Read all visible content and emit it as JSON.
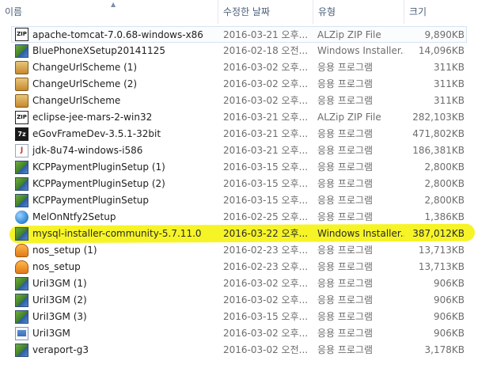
{
  "columns": {
    "name": "이름",
    "date": "수정한 날짜",
    "type": "유형",
    "size": "크기"
  },
  "files": [
    {
      "name": "apache-tomcat-7.0.68-windows-x86",
      "date": "2016-03-21 오후...",
      "type": "ALZip ZIP File",
      "size": "9,890KB",
      "icon": "zip-icon",
      "selected": true
    },
    {
      "name": "BluePhoneXSetup20141125",
      "date": "2016-02-18 오전...",
      "type": "Windows Installer...",
      "size": "14,096KB",
      "icon": "installer-icon"
    },
    {
      "name": "ChangeUrlScheme (1)",
      "date": "2016-03-02 오후...",
      "type": "응용 프로그램",
      "size": "311KB",
      "icon": "application-icon"
    },
    {
      "name": "ChangeUrlScheme (2)",
      "date": "2016-03-02 오후...",
      "type": "응용 프로그램",
      "size": "311KB",
      "icon": "application-icon"
    },
    {
      "name": "ChangeUrlScheme",
      "date": "2016-03-02 오후...",
      "type": "응용 프로그램",
      "size": "311KB",
      "icon": "application-icon"
    },
    {
      "name": "eclipse-jee-mars-2-win32",
      "date": "2016-03-21 오후...",
      "type": "ALZip ZIP File",
      "size": "282,103KB",
      "icon": "zip-icon"
    },
    {
      "name": "eGovFrameDev-3.5.1-32bit",
      "date": "2016-03-21 오후...",
      "type": "응용 프로그램",
      "size": "471,802KB",
      "icon": "7z-icon"
    },
    {
      "name": "jdk-8u74-windows-i586",
      "date": "2016-03-21 오후...",
      "type": "응용 프로그램",
      "size": "186,381KB",
      "icon": "java-icon"
    },
    {
      "name": "KCPPaymentPluginSetup (1)",
      "date": "2016-03-15 오후...",
      "type": "응용 프로그램",
      "size": "2,800KB",
      "icon": "installer-icon"
    },
    {
      "name": "KCPPaymentPluginSetup (2)",
      "date": "2016-03-15 오후...",
      "type": "응용 프로그램",
      "size": "2,800KB",
      "icon": "installer-icon"
    },
    {
      "name": "KCPPaymentPluginSetup",
      "date": "2016-03-15 오후...",
      "type": "응용 프로그램",
      "size": "2,800KB",
      "icon": "installer-icon"
    },
    {
      "name": "MelOnNtfy2Setup",
      "date": "2016-02-25 오후...",
      "type": "응용 프로그램",
      "size": "1,386KB",
      "icon": "globe-icon"
    },
    {
      "name": "mysql-installer-community-5.7.11.0",
      "date": "2016-03-22 오후...",
      "type": "Windows Installer...",
      "size": "387,012KB",
      "icon": "installer-icon",
      "highlighted": true
    },
    {
      "name": "nos_setup (1)",
      "date": "2016-02-23 오후...",
      "type": "응용 프로그램",
      "size": "13,713KB",
      "icon": "shield-icon"
    },
    {
      "name": "nos_setup",
      "date": "2016-02-23 오후...",
      "type": "응용 프로그램",
      "size": "13,713KB",
      "icon": "shield-icon"
    },
    {
      "name": "UriI3GM (1)",
      "date": "2016-03-02 오후...",
      "type": "응용 프로그램",
      "size": "906KB",
      "icon": "installer-icon"
    },
    {
      "name": "UriI3GM (2)",
      "date": "2016-03-02 오후...",
      "type": "응용 프로그램",
      "size": "906KB",
      "icon": "installer-icon"
    },
    {
      "name": "UriI3GM (3)",
      "date": "2016-03-15 오후...",
      "type": "응용 프로그램",
      "size": "906KB",
      "icon": "installer-icon"
    },
    {
      "name": "UriI3GM",
      "date": "2016-03-02 오후...",
      "type": "응용 프로그램",
      "size": "906KB",
      "icon": "document-icon"
    },
    {
      "name": "veraport-g3",
      "date": "2016-03-02 오전...",
      "type": "응용 프로그램",
      "size": "3,178KB",
      "icon": "installer-icon"
    }
  ],
  "colors": {
    "highlight": "#f5f200",
    "header_text": "#4c607a",
    "meta_text": "#6d6d6d"
  }
}
